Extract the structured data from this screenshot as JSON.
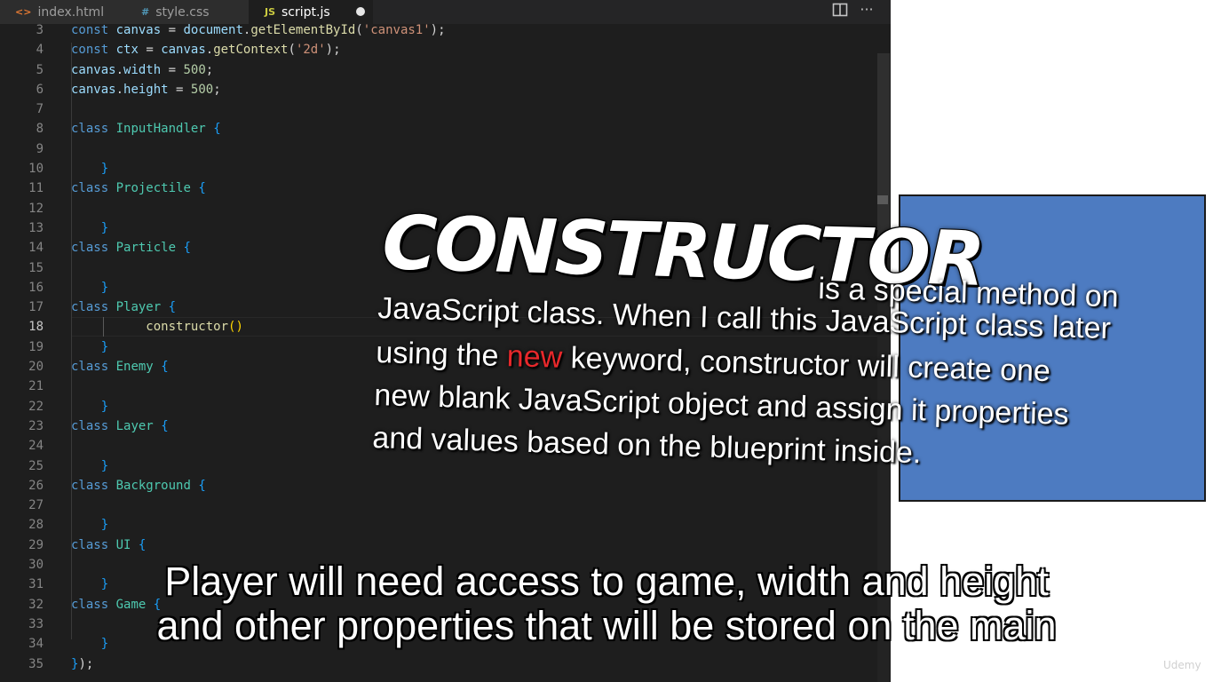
{
  "tabs": [
    {
      "label": "index.html",
      "icon": "html-icon",
      "glyph": "<>"
    },
    {
      "label": "style.css",
      "icon": "css-icon",
      "glyph": "#"
    },
    {
      "label": "script.js",
      "icon": "js-icon",
      "glyph": "JS"
    }
  ],
  "toolbar": {
    "more_glyph": "···"
  },
  "code_lines": [
    {
      "n": "3",
      "text": "const canvas = document.getElementById('canvas1');"
    },
    {
      "n": "4",
      "text": "const ctx = canvas.getContext('2d');"
    },
    {
      "n": "5",
      "text": "canvas.width = 500;"
    },
    {
      "n": "6",
      "text": "canvas.height = 500;"
    },
    {
      "n": "7",
      "text": ""
    },
    {
      "n": "8",
      "text": "class InputHandler {"
    },
    {
      "n": "9",
      "text": ""
    },
    {
      "n": "10",
      "text": "}"
    },
    {
      "n": "11",
      "text": "class Projectile {"
    },
    {
      "n": "12",
      "text": ""
    },
    {
      "n": "13",
      "text": "}"
    },
    {
      "n": "14",
      "text": "class Particle {"
    },
    {
      "n": "15",
      "text": ""
    },
    {
      "n": "16",
      "text": "}"
    },
    {
      "n": "17",
      "text": "class Player {"
    },
    {
      "n": "18",
      "text": "constructor()"
    },
    {
      "n": "19",
      "text": "}"
    },
    {
      "n": "20",
      "text": "class Enemy {"
    },
    {
      "n": "21",
      "text": ""
    },
    {
      "n": "22",
      "text": "}"
    },
    {
      "n": "23",
      "text": "class Layer {"
    },
    {
      "n": "24",
      "text": ""
    },
    {
      "n": "25",
      "text": "}"
    },
    {
      "n": "26",
      "text": "class Background {"
    },
    {
      "n": "27",
      "text": ""
    },
    {
      "n": "28",
      "text": "}"
    },
    {
      "n": "29",
      "text": "class UI {"
    },
    {
      "n": "30",
      "text": ""
    },
    {
      "n": "31",
      "text": "}"
    },
    {
      "n": "32",
      "text": "class Game {"
    },
    {
      "n": "33",
      "text": ""
    },
    {
      "n": "34",
      "text": "}"
    },
    {
      "n": "35",
      "text": "});"
    }
  ],
  "overlay": {
    "title": "CONSTRUCTOR",
    "line0": "is a special method on",
    "line1": "JavaScript class. When I call this JavaScript class later",
    "line2_a": "using the ",
    "line2_keyword": "new",
    "line2_b": " keyword, constructor will create one",
    "line3": "new blank JavaScript object and assign it properties",
    "line4": "and values based on the blueprint inside."
  },
  "subtitles": {
    "line1": "Player will need access to game, width and height",
    "line2": "and other properties that will be stored on the main"
  },
  "watermark": "Udemy",
  "colors": {
    "preview_canvas": "#4d7bc1",
    "editor_bg": "#1e1e1e",
    "keyword_highlight": "#e8282b"
  }
}
